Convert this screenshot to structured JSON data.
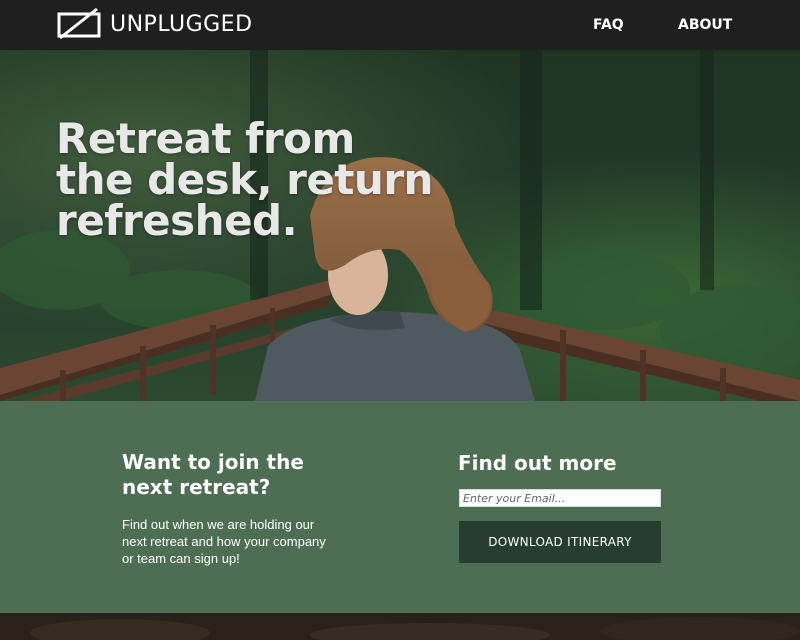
{
  "header": {
    "brand": "UNPLUGGED",
    "logo_icon": "unplugged-logo-icon",
    "nav": [
      {
        "label": "FAQ"
      },
      {
        "label": "ABOUT"
      }
    ]
  },
  "hero": {
    "headline": "Retreat from the desk, return refreshed."
  },
  "signup": {
    "join_title": "Want to join the next retreat?",
    "join_text": "Find out when we are holding our next retreat and how your company or team can sign up!",
    "more_title": "Find out more",
    "email_placeholder": "Enter your Email...",
    "download_label": "DOWNLOAD ITINERARY"
  },
  "colors": {
    "header_bg": "#1f1f1f",
    "panel_green": "#4e6e53",
    "button_dark": "#283d31"
  }
}
